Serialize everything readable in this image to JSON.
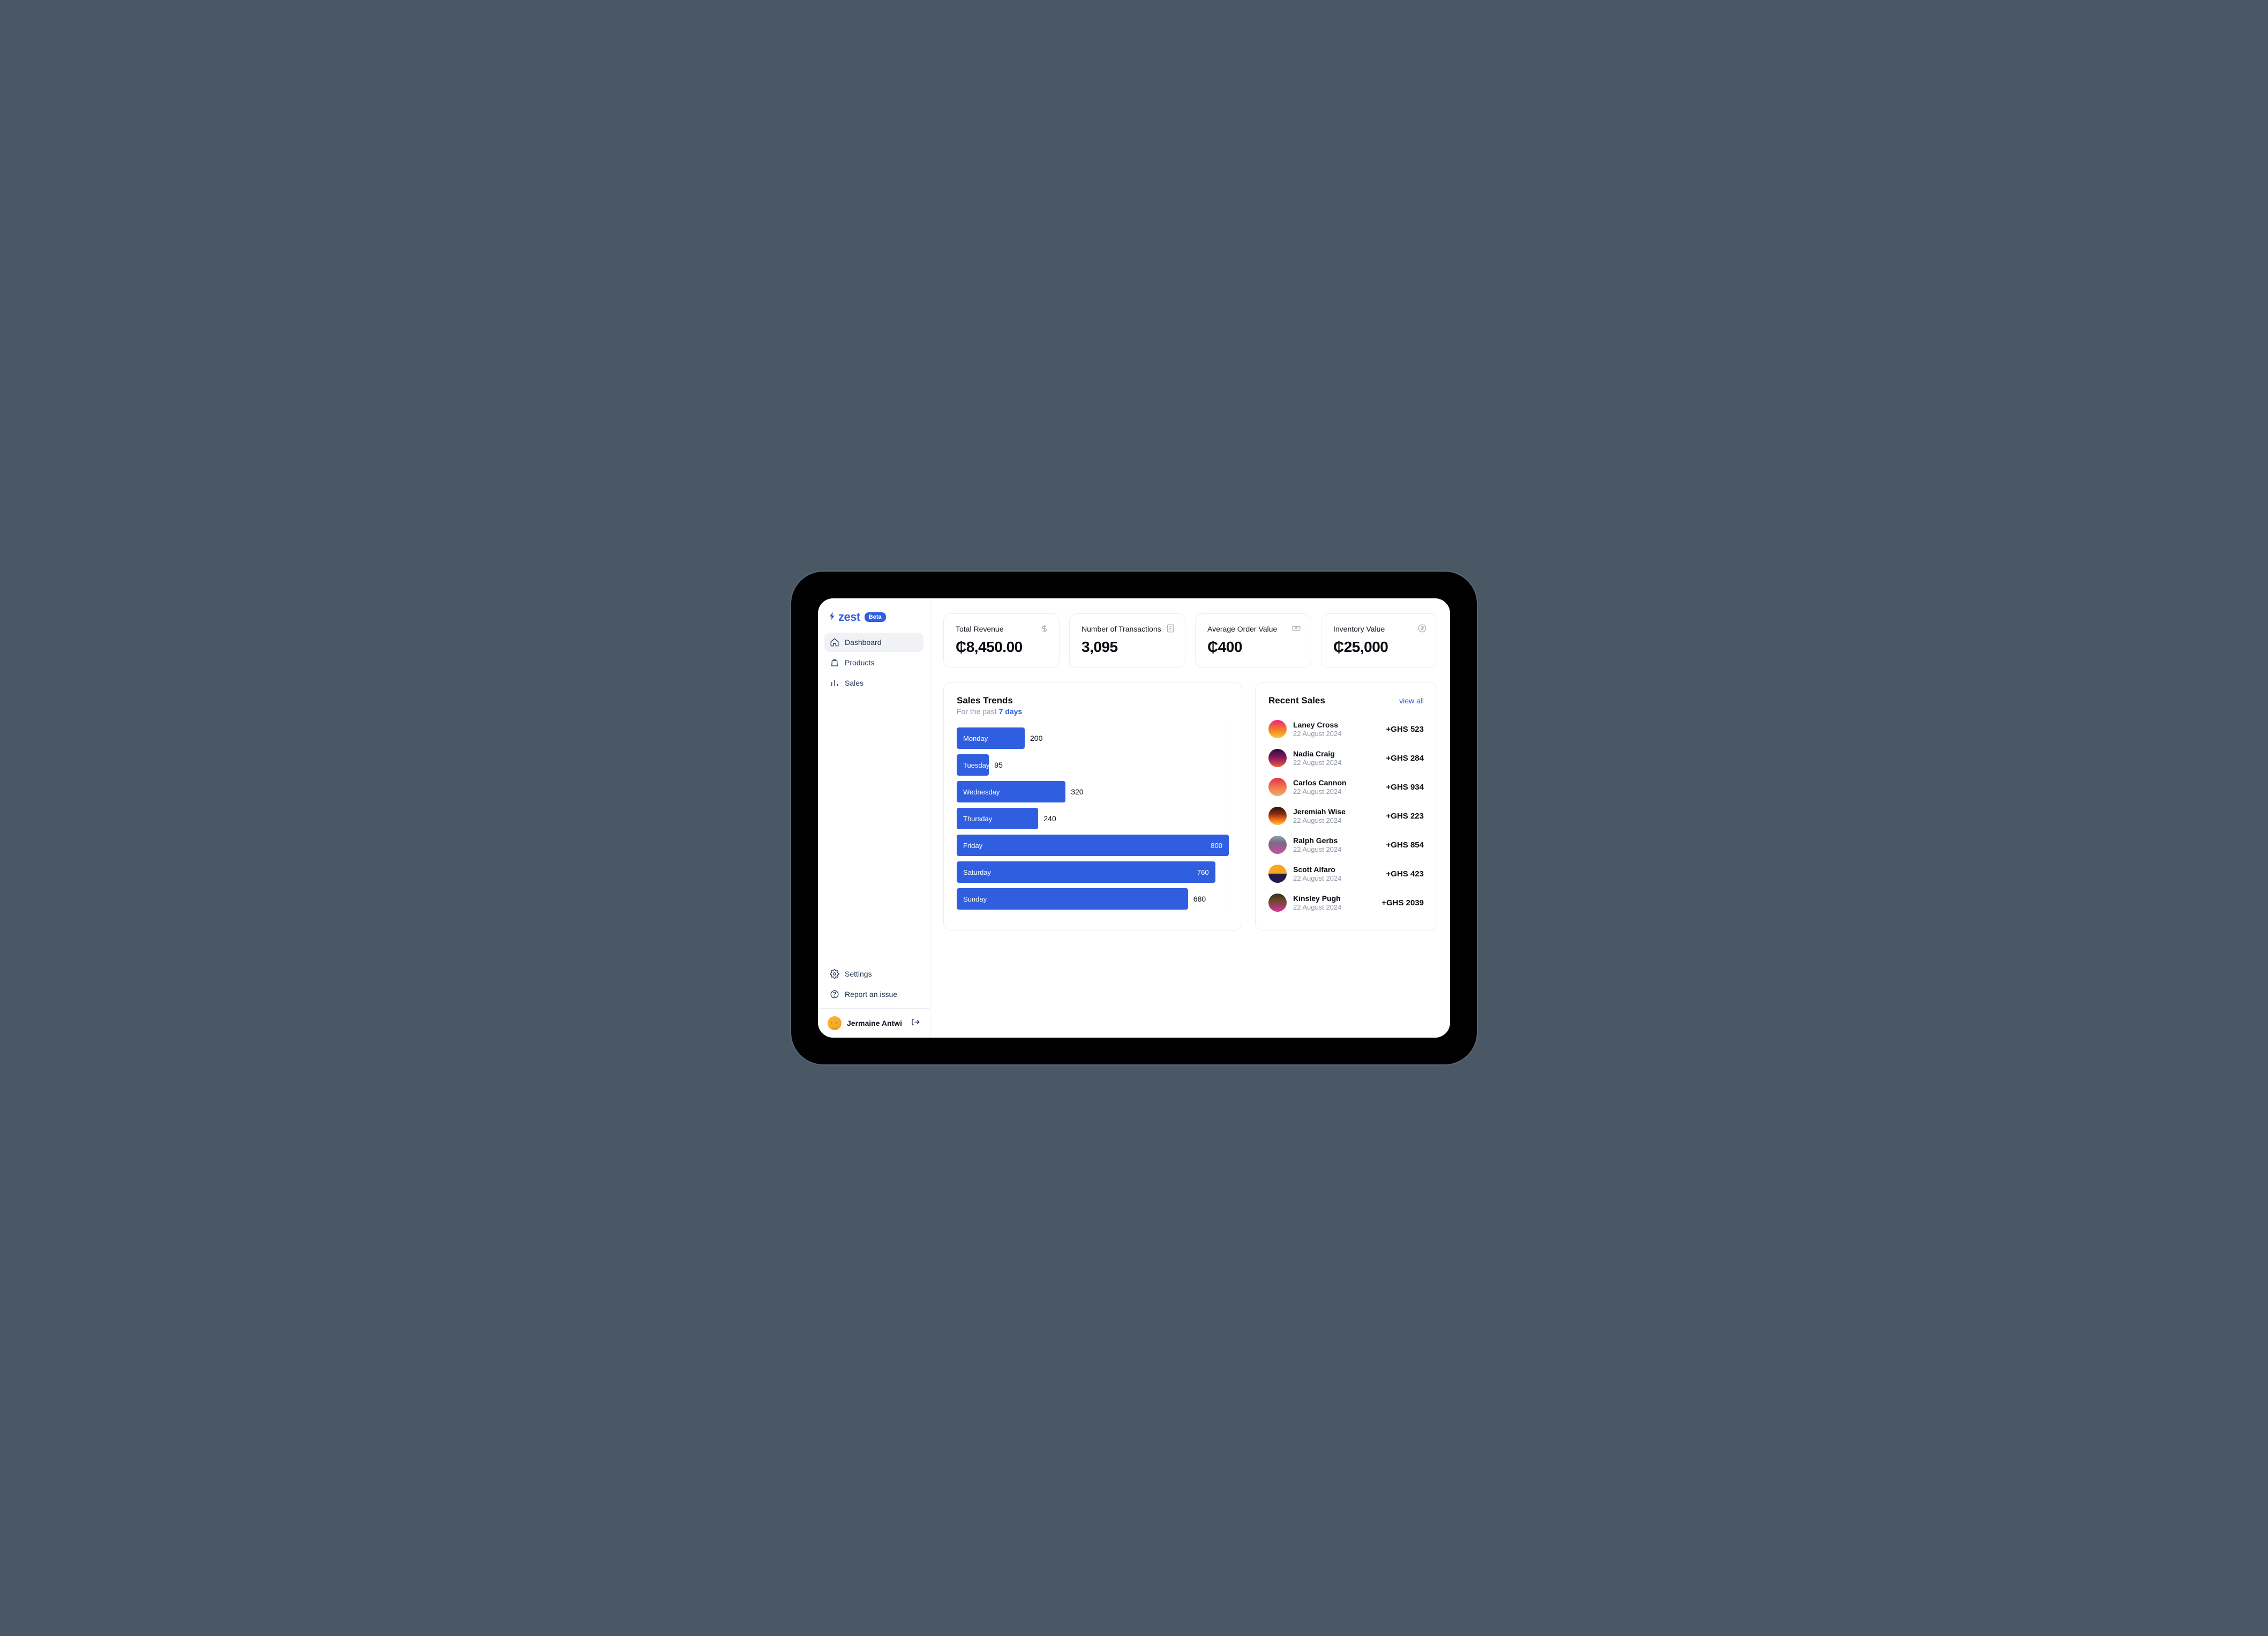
{
  "brand": {
    "name": "zest",
    "badge": "Beta"
  },
  "sidebar": {
    "items": [
      {
        "label": "Dashboard",
        "active": true
      },
      {
        "label": "Products",
        "active": false
      },
      {
        "label": "Sales",
        "active": false
      }
    ],
    "bottom": [
      {
        "label": "Settings"
      },
      {
        "label": "Report an issue"
      }
    ],
    "user": {
      "name": "Jermaine Antwi"
    }
  },
  "metrics": [
    {
      "label": "Total Revenue",
      "value": "₵8,450.00",
      "icon": "dollar"
    },
    {
      "label": "Number of Transactions",
      "value": "3,095",
      "icon": "receipt"
    },
    {
      "label": "Average Order Value",
      "value": "₵400",
      "icon": "banknote"
    },
    {
      "label": "Inventory Value",
      "value": "₵25,000",
      "icon": "coin"
    }
  ],
  "salesTrends": {
    "title": "Sales Trends",
    "subtitle_prefix": "For the past ",
    "subtitle_range": "7 days"
  },
  "recent": {
    "title": "Recent Sales",
    "view_all": "view all",
    "rows": [
      {
        "name": "Laney Cross",
        "date": "22 August 2024",
        "amount": "+GHS 523",
        "grad": "grad1"
      },
      {
        "name": "Nadia Craig",
        "date": "22 August 2024",
        "amount": "+GHS 284",
        "grad": "grad2"
      },
      {
        "name": "Carlos Cannon",
        "date": "22 August 2024",
        "amount": "+GHS 934",
        "grad": "grad3"
      },
      {
        "name": "Jeremiah Wise",
        "date": "22 August 2024",
        "amount": "+GHS 223",
        "grad": "grad4"
      },
      {
        "name": "Ralph Gerbs",
        "date": "22 August 2024",
        "amount": "+GHS 854",
        "grad": "grad5"
      },
      {
        "name": "Scott Alfaro",
        "date": "22 August 2024",
        "amount": "+GHS 423",
        "grad": "grad6"
      },
      {
        "name": "Kinsley Pugh",
        "date": "22 August 2024",
        "amount": "+GHS 2039",
        "grad": "grad7"
      }
    ]
  },
  "chart_data": {
    "type": "bar",
    "orientation": "horizontal",
    "title": "Sales Trends",
    "categories": [
      "Monday",
      "Tuesday",
      "Wednesday",
      "Thursday",
      "Friday",
      "Saturday",
      "Sunday"
    ],
    "values": [
      200,
      95,
      320,
      240,
      800,
      760,
      680
    ],
    "xlim": [
      0,
      800
    ],
    "xlabel": "",
    "ylabel": ""
  }
}
